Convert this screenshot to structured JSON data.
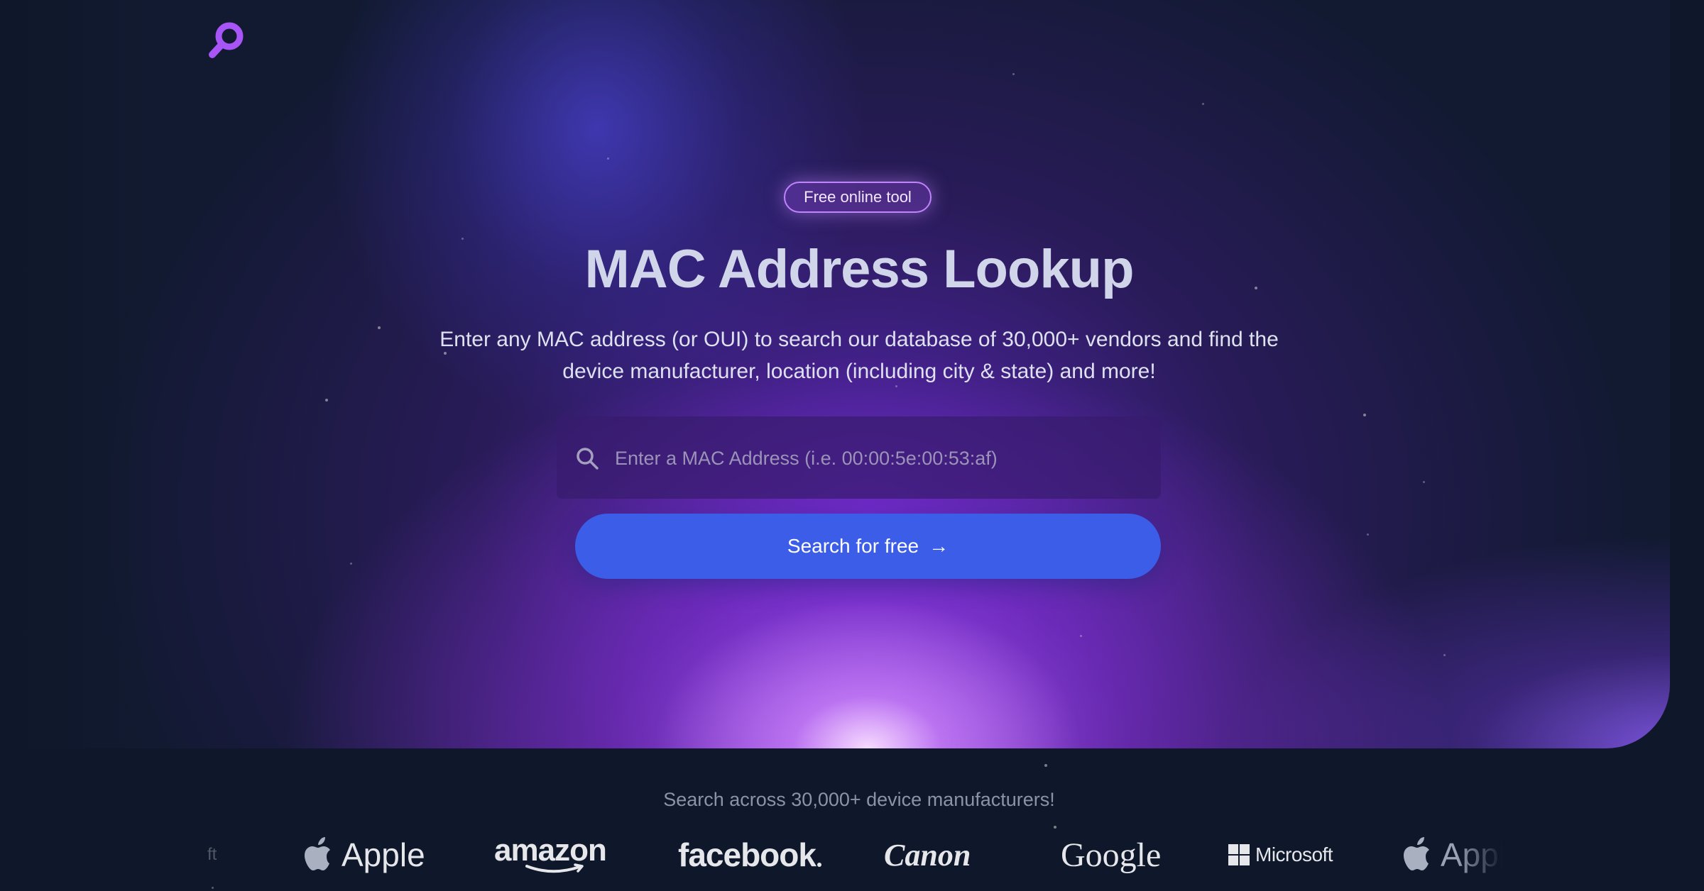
{
  "logo": {
    "icon": "magnifier-logo-icon",
    "color": "#a855f7"
  },
  "hero": {
    "badge": "Free online tool",
    "title": "MAC Address Lookup",
    "subtitle_line1": "Enter any MAC address (or OUI) to search our database of 30,000+ vendors and find the",
    "subtitle_line2": "device manufacturer, location (including city & state) and more!"
  },
  "search": {
    "placeholder": "Enter a MAC Address (i.e. 00:00:5e:00:53:af)",
    "value": "",
    "icon": "search-icon",
    "button_label": "Search for free",
    "button_icon": "arrow-right-icon",
    "button_color": "#3b5de7"
  },
  "brands": {
    "caption": "Search across 30,000+ device manufacturers!",
    "items": [
      {
        "name": "microsoft-partial",
        "label": "ft"
      },
      {
        "name": "apple",
        "label": "Apple"
      },
      {
        "name": "amazon",
        "label": "amazon"
      },
      {
        "name": "facebook",
        "label": "facebook"
      },
      {
        "name": "canon",
        "label": "Canon"
      },
      {
        "name": "google",
        "label": "Google"
      },
      {
        "name": "microsoft",
        "label": "Microsoft"
      },
      {
        "name": "apple-repeat",
        "label": "Apple"
      }
    ]
  }
}
